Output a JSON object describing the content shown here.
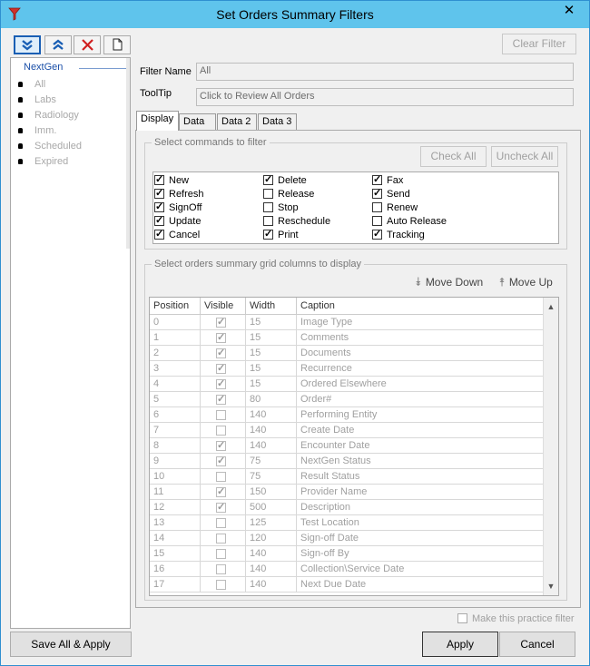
{
  "window": {
    "title": "Set Orders Summary Filters",
    "close_glyph": "✕",
    "app_icon": "funnel-icon"
  },
  "toolbar": {
    "move_down_icon": "⯯",
    "move_up_icon": "⯭",
    "delete_icon": "✕",
    "new_icon": "🗋"
  },
  "clear_filter_label": "Clear Filter",
  "tree": {
    "root": "NextGen",
    "items": [
      "All",
      "Labs",
      "Radiology",
      "Imm.",
      "Scheduled",
      "Expired"
    ]
  },
  "filter_name": {
    "label": "Filter Name",
    "value": "All"
  },
  "tooltip": {
    "label": "ToolTip",
    "value": "Click to Review All Orders"
  },
  "tabs": [
    "Display",
    "Data",
    "Data 2",
    "Data 3"
  ],
  "commands_group": {
    "title": "Select commands to filter",
    "check_all": "Check All",
    "uncheck_all": "Uncheck All",
    "items": [
      {
        "label": "New",
        "checked": true
      },
      {
        "label": "Refresh",
        "checked": true
      },
      {
        "label": "SignOff",
        "checked": true
      },
      {
        "label": "Update",
        "checked": true
      },
      {
        "label": "Cancel",
        "checked": true
      },
      {
        "label": "Delete",
        "checked": true
      },
      {
        "label": "Release",
        "checked": false
      },
      {
        "label": "Stop",
        "checked": false
      },
      {
        "label": "Reschedule",
        "checked": false
      },
      {
        "label": "Print",
        "checked": true
      },
      {
        "label": "Fax",
        "checked": true
      },
      {
        "label": "Send",
        "checked": true
      },
      {
        "label": "Renew",
        "checked": false
      },
      {
        "label": "Auto Release",
        "checked": false
      },
      {
        "label": "Tracking",
        "checked": true
      }
    ]
  },
  "columns_group": {
    "title": "Select orders summary grid columns to display",
    "move_down": "Move Down",
    "move_up": "Move Up",
    "headers": [
      "Position",
      "Visible",
      "Width",
      "Caption"
    ],
    "rows": [
      {
        "pos": "0",
        "visible": true,
        "width": "15",
        "caption": "Image Type"
      },
      {
        "pos": "1",
        "visible": true,
        "width": "15",
        "caption": "Comments"
      },
      {
        "pos": "2",
        "visible": true,
        "width": "15",
        "caption": "Documents"
      },
      {
        "pos": "3",
        "visible": true,
        "width": "15",
        "caption": "Recurrence"
      },
      {
        "pos": "4",
        "visible": true,
        "width": "15",
        "caption": "Ordered Elsewhere"
      },
      {
        "pos": "5",
        "visible": true,
        "width": "80",
        "caption": "Order#"
      },
      {
        "pos": "6",
        "visible": false,
        "width": "140",
        "caption": "Performing Entity"
      },
      {
        "pos": "7",
        "visible": false,
        "width": "140",
        "caption": "Create Date"
      },
      {
        "pos": "8",
        "visible": true,
        "width": "140",
        "caption": "Encounter Date"
      },
      {
        "pos": "9",
        "visible": true,
        "width": "75",
        "caption": "NextGen Status"
      },
      {
        "pos": "10",
        "visible": false,
        "width": "75",
        "caption": "Result Status"
      },
      {
        "pos": "11",
        "visible": true,
        "width": "150",
        "caption": "Provider Name"
      },
      {
        "pos": "12",
        "visible": true,
        "width": "500",
        "caption": "Description"
      },
      {
        "pos": "13",
        "visible": false,
        "width": "125",
        "caption": "Test Location"
      },
      {
        "pos": "14",
        "visible": false,
        "width": "120",
        "caption": "Sign-off Date"
      },
      {
        "pos": "15",
        "visible": false,
        "width": "140",
        "caption": "Sign-off By"
      },
      {
        "pos": "16",
        "visible": false,
        "width": "140",
        "caption": "Collection\\Service Date"
      },
      {
        "pos": "17",
        "visible": false,
        "width": "140",
        "caption": "Next Due Date"
      }
    ]
  },
  "practice_filter": {
    "label": "Make this practice filter",
    "checked": false
  },
  "buttons": {
    "save_all": "Save All & Apply",
    "apply": "Apply",
    "cancel": "Cancel"
  }
}
